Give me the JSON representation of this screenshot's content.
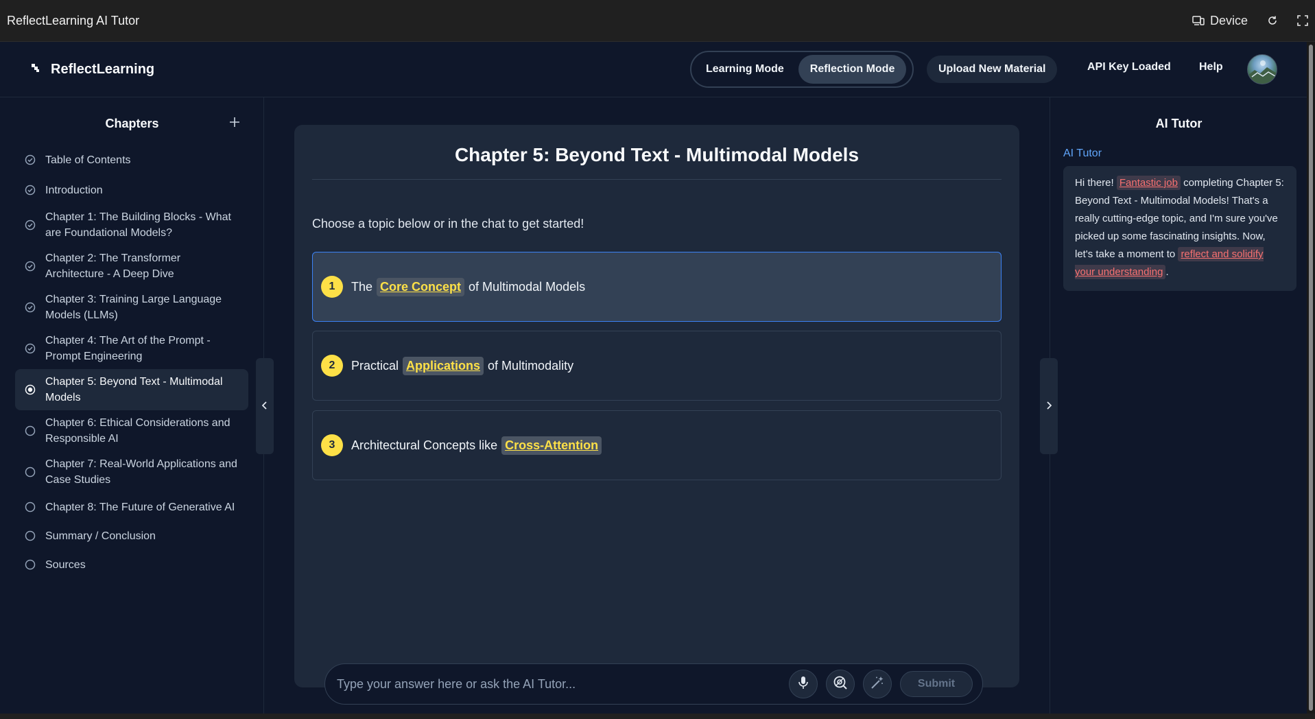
{
  "window": {
    "title": "ReflectLearning AI Tutor",
    "device_label": "Device",
    "icons": [
      "device-icon",
      "refresh-icon",
      "fullscreen-icon"
    ]
  },
  "header": {
    "brand": "ReflectLearning",
    "modes": [
      {
        "label": "Learning Mode",
        "active": false
      },
      {
        "label": "Reflection Mode",
        "active": true
      }
    ],
    "upload_label": "Upload New Material",
    "api_status": "API Key Loaded",
    "help_label": "Help"
  },
  "sidebar": {
    "title": "Chapters",
    "add_icon": "plus-icon",
    "items": [
      {
        "label": "Table of Contents",
        "status": "completed"
      },
      {
        "label": "Introduction",
        "status": "completed"
      },
      {
        "label": "Chapter 1: The Building Blocks - What are Foundational Models?",
        "status": "completed"
      },
      {
        "label": "Chapter 2: The Transformer Architecture - A Deep Dive",
        "status": "completed"
      },
      {
        "label": "Chapter 3: Training Large Language Models (LLMs)",
        "status": "completed"
      },
      {
        "label": "Chapter 4: The Art of the Prompt - Prompt Engineering",
        "status": "completed"
      },
      {
        "label": "Chapter 5: Beyond Text - Multimodal Models",
        "status": "current"
      },
      {
        "label": "Chapter 6: Ethical Considerations and Responsible AI",
        "status": "pending"
      },
      {
        "label": "Chapter 7: Real-World Applications and Case Studies",
        "status": "pending"
      },
      {
        "label": "Chapter 8: The Future of Generative AI",
        "status": "pending"
      },
      {
        "label": "Summary / Conclusion",
        "status": "pending"
      },
      {
        "label": "Sources",
        "status": "pending"
      }
    ]
  },
  "main": {
    "title": "Chapter 5: Beyond Text - Multimodal Models",
    "prompt": "Choose a topic below or in the chat to get started!",
    "topics": [
      {
        "number": "1",
        "before": "The",
        "highlight": "Core Concept",
        "after": "of Multimodal Models",
        "selected": true
      },
      {
        "number": "2",
        "before": "Practical",
        "highlight": "Applications",
        "after": "of Multimodality",
        "selected": false
      },
      {
        "number": "3",
        "before": "Architectural Concepts like",
        "highlight": "Cross-Attention",
        "after": "",
        "selected": false
      }
    ]
  },
  "chat": {
    "placeholder": "Type your answer here or ask the AI Tutor...",
    "submit_label": "Submit",
    "icons": [
      "microphone-icon",
      "screen-search-icon",
      "magic-wand-icon"
    ]
  },
  "tutor": {
    "title": "AI Tutor",
    "sender": "AI Tutor",
    "message": {
      "p1": "Hi there!",
      "h1": "Fantastic job",
      "p2": "completing Chapter 5: Beyond Text - Multimodal Models! That's a really cutting-edge topic, and I'm sure you've picked up some fascinating insights. Now, let's take a moment to",
      "h2": "reflect and solidify your understanding",
      "p3": "."
    }
  },
  "colors": {
    "background": "#0f172a",
    "card": "#1e293b",
    "accent_yellow": "#fde047",
    "highlight_red": "#f87171",
    "link_blue": "#60a5fa",
    "selected_border": "#3b82f6"
  }
}
